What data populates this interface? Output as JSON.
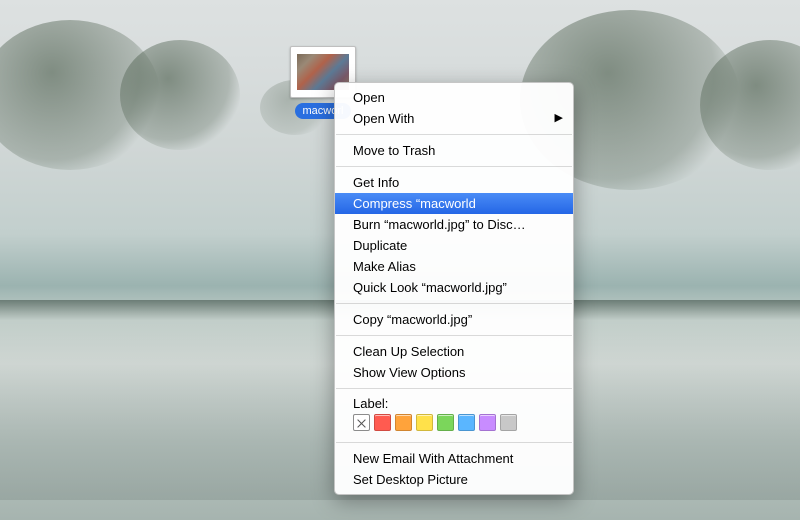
{
  "file": {
    "name": "macworl"
  },
  "menu": {
    "open": "Open",
    "open_with": "Open With",
    "move_to_trash": "Move to Trash",
    "get_info": "Get Info",
    "compress": "Compress “macworld",
    "burn": "Burn “macworld.jpg” to Disc…",
    "duplicate": "Duplicate",
    "make_alias": "Make Alias",
    "quick_look": "Quick Look “macworld.jpg”",
    "copy": "Copy “macworld.jpg”",
    "clean_up": "Clean Up Selection",
    "view_options": "Show View Options",
    "label_header": "Label:",
    "new_email": "New Email With Attachment",
    "set_desktop": "Set Desktop Picture"
  },
  "label_colors": [
    "#ff5b50",
    "#ffa33b",
    "#ffe14a",
    "#7bd65b",
    "#5ab6ff",
    "#c88cff",
    "#c8c8c8"
  ]
}
